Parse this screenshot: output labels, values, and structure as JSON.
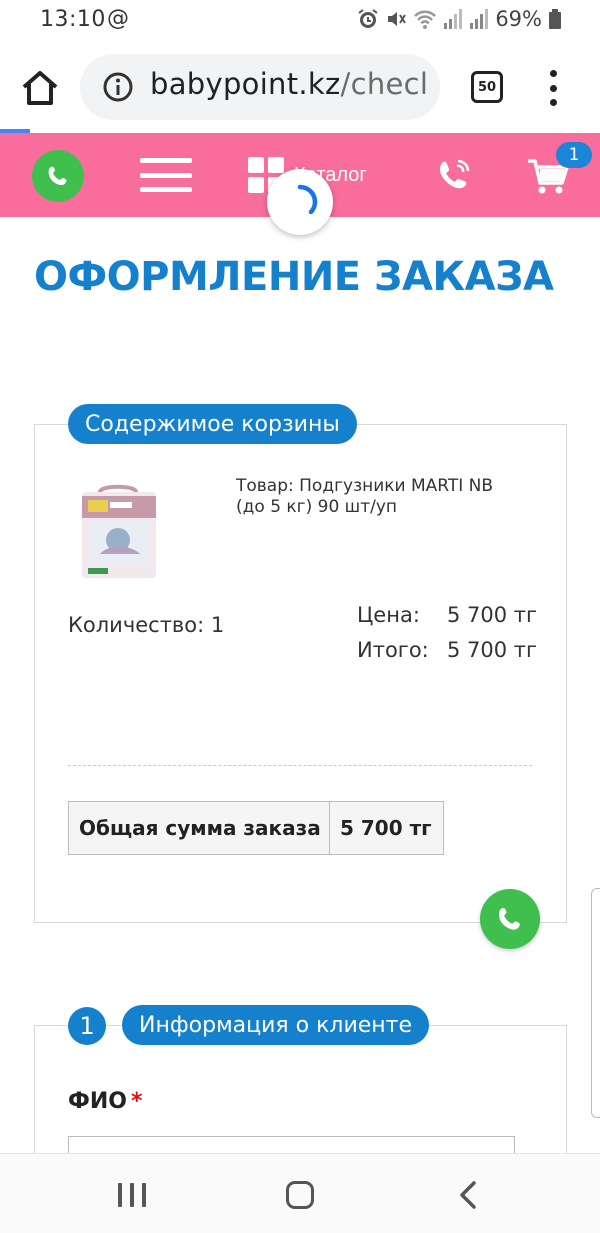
{
  "status_bar": {
    "time": "13:10",
    "at_symbol": "@",
    "battery_percent": "69%",
    "icons": [
      "alarm-icon",
      "mute-icon",
      "wifi-icon",
      "signal-icon",
      "signal-icon",
      "battery-icon"
    ]
  },
  "browser": {
    "url_domain": "babypoint.kz",
    "url_path": "/checl",
    "tab_count": "50",
    "icons": [
      "home-icon",
      "info-icon",
      "tabs-icon",
      "more-vert-icon"
    ]
  },
  "header": {
    "catalog_label": "Каталог",
    "cart_count": "1",
    "colors": {
      "background": "#f86d9b",
      "whatsapp": "#3fbf4e",
      "badge": "#1b86d8"
    },
    "icons": [
      "whatsapp-icon",
      "hamburger-icon",
      "grid-icon",
      "phone-icon",
      "cart-icon",
      "loading-spinner-icon"
    ]
  },
  "page": {
    "title": "ОФОРМЛЕНИЕ ЗАКАЗА",
    "accent_color": "#1580cc"
  },
  "cart": {
    "legend": "Содержимое корзины",
    "item": {
      "name": "Товар: Подгузники MARTI NB (до 5 кг) 90 шт/уп",
      "quantity_label": "Количество: 1",
      "price_label": "Цена:",
      "price_value": "5 700 тг",
      "total_label": "Итого:",
      "total_value": "5 700 тг"
    },
    "order_total_label": "Общая сумма заказа",
    "order_total_value": "5 700 тг"
  },
  "client": {
    "step_number": "1",
    "legend": "Информация о клиенте",
    "fio_label": "ФИО",
    "required_mark": "*"
  }
}
